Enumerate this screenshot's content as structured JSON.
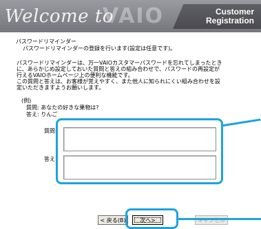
{
  "banner": {
    "welcome": "Welcome to",
    "logo": "VAIO",
    "title_line1": "Customer",
    "title_line2": "Registration"
  },
  "section": {
    "title": "パスワードリマインダー",
    "intro": "パスワードリマインダーの登録を行います(設定は任意です)。",
    "desc_lines": [
      "パスワードリマインダーは、万一VAIOカスタマーパスワードを忘れてしまったとき",
      "に、あらかじめ設定しておいた質問と答えの組み合わせで、パスワードの再設定が",
      "行えるVAIOホームページ上の便利な機能です。",
      "この質問と答えは、お客様が覚えやすく、また他人に知られにくい組み合わせを設",
      "定いただきますようお願いします。"
    ]
  },
  "example": {
    "title": "(例)",
    "question_line": "質問: あなたの好きな果物は?",
    "answer_line": "答え: りんご"
  },
  "form": {
    "question_label": "質問:",
    "question_value": "",
    "answer_label": "答え:",
    "answer_value": ""
  },
  "buttons": {
    "back": "< 戻る(B)",
    "next": "次へ>",
    "cancel": "キャンセル"
  },
  "colors": {
    "highlight": "#1ca3de",
    "banner": "#8a8a90"
  }
}
